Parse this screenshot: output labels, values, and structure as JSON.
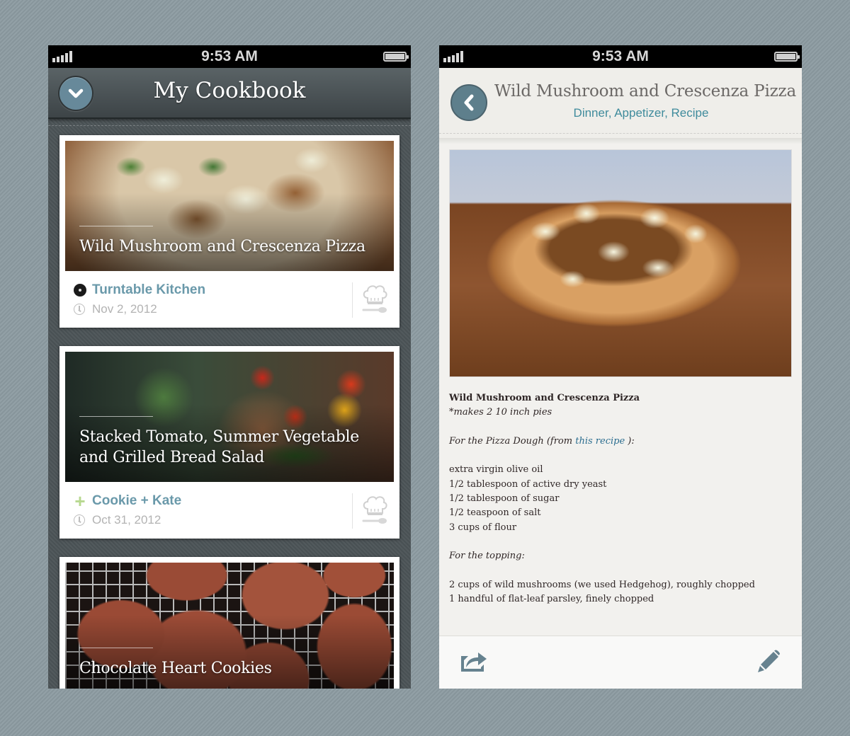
{
  "status_bar": {
    "time": "9:53 AM",
    "signal_bars": 5,
    "battery_level": 1.0
  },
  "left_screen": {
    "title": "My Cookbook",
    "nav_button_icon": "chevron-down-icon",
    "cards": [
      {
        "title": "Wild Mushroom and Crescenza Pizza",
        "source": "Turntable Kitchen",
        "source_icon": "vinyl-record-icon",
        "date": "Nov 2, 2012",
        "action_icon": "chef-hat-spoon-icon"
      },
      {
        "title": "Stacked Tomato, Summer Vegetable and Grilled Bread Salad",
        "source": "Cookie + Kate",
        "source_icon": "plus-icon",
        "date": "Oct 31, 2012",
        "action_icon": "chef-hat-spoon-icon"
      },
      {
        "title": "Chocolate Heart Cookies"
      }
    ]
  },
  "right_screen": {
    "back_icon": "chevron-left-icon",
    "title": "Wild Mushroom and Crescenza Pizza",
    "tags": "Dinner, Appetizer, Recipe",
    "body": {
      "heading": "Wild Mushroom and Crescenza Pizza",
      "yield": "*makes 2 10 inch pies",
      "dough_intro_before": "For the Pizza Dough (from ",
      "dough_link": "this recipe",
      "dough_intro_after": " ):",
      "dough_ingredients": [
        "extra virgin olive oil",
        "1/2 tablespoon of active dry yeast",
        "1/2 tablespoon of sugar",
        "1/2 teaspoon of salt",
        "3 cups of flour"
      ],
      "topping_intro": "For the topping:",
      "topping_ingredients": [
        "2 cups of wild mushrooms (we used Hedgehog), roughly chopped",
        "1 handful of flat-leaf parsley, finely chopped"
      ]
    },
    "footer": {
      "share_icon": "share-icon",
      "edit_icon": "pencil-icon"
    }
  },
  "colors": {
    "accent_blue": "#6a99aa",
    "tag_teal": "#3f8b9c",
    "button_slate": "#5e7f8c",
    "plus_green": "#b7d88f",
    "link_blue": "#2b6d8f"
  }
}
